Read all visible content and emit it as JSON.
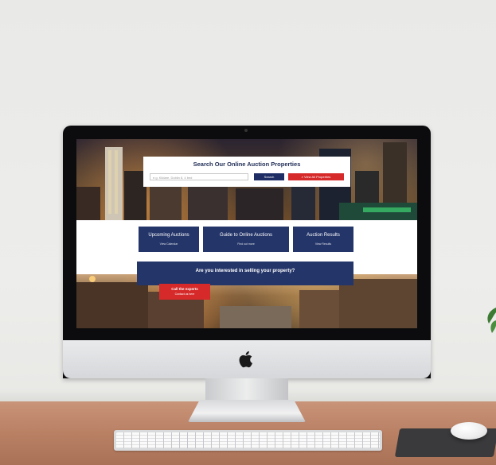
{
  "website": {
    "search": {
      "title": "Search Our Online Auction Properties",
      "placeholder": "e.g. Kildare, Dublin 8, 4 bed",
      "search_label": "Search",
      "view_all_label": "View All Properties"
    },
    "tiles": [
      {
        "title": "Upcoming Auctions",
        "subtitle": "View Calendar"
      },
      {
        "title": "Guide to Online Auctions",
        "subtitle": "Find out more"
      },
      {
        "title": "Auction Results",
        "subtitle": "View Results"
      }
    ],
    "cta": {
      "question": "Are you interested in selling your property?",
      "button_title": "Call the experts",
      "button_sub": "Contact us here"
    }
  },
  "colors": {
    "navy": "#243569",
    "red": "#d62a2a"
  },
  "icons": {
    "brand": "apple-logo",
    "search": "search-icon"
  }
}
